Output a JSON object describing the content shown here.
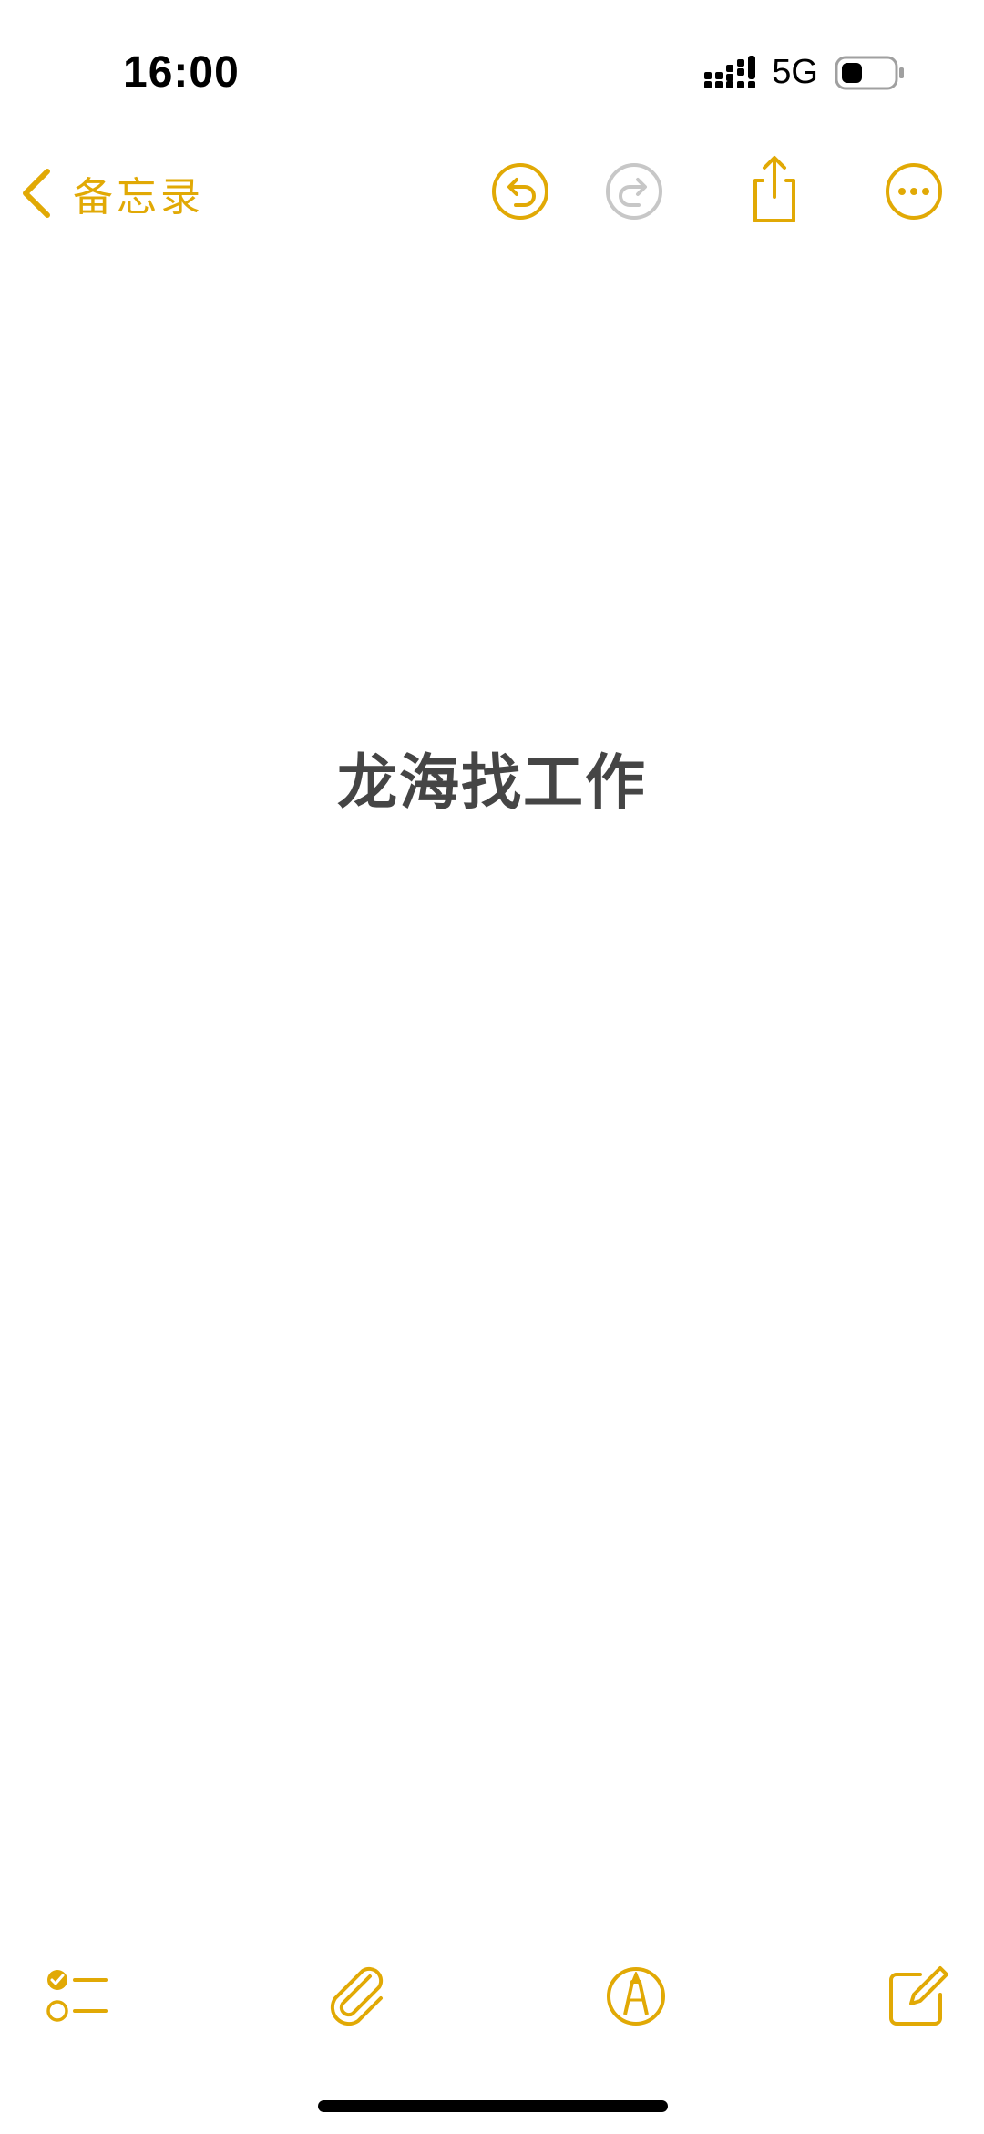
{
  "status_bar": {
    "time": "16:00",
    "network": "5G",
    "icons": [
      "signal-icon",
      "battery-icon"
    ]
  },
  "nav": {
    "back_label": "备忘录",
    "icons": [
      "chevron-left-icon",
      "undo-icon",
      "redo-icon",
      "share-icon",
      "more-icon"
    ]
  },
  "note": {
    "title": "龙海找工作"
  },
  "toolbar": {
    "icons": [
      "checklist-icon",
      "paperclip-icon",
      "markup-icon",
      "compose-icon"
    ]
  },
  "colors": {
    "accent": "#E1A905",
    "disabled": "#C7C7C7",
    "title_text": "#454545"
  }
}
